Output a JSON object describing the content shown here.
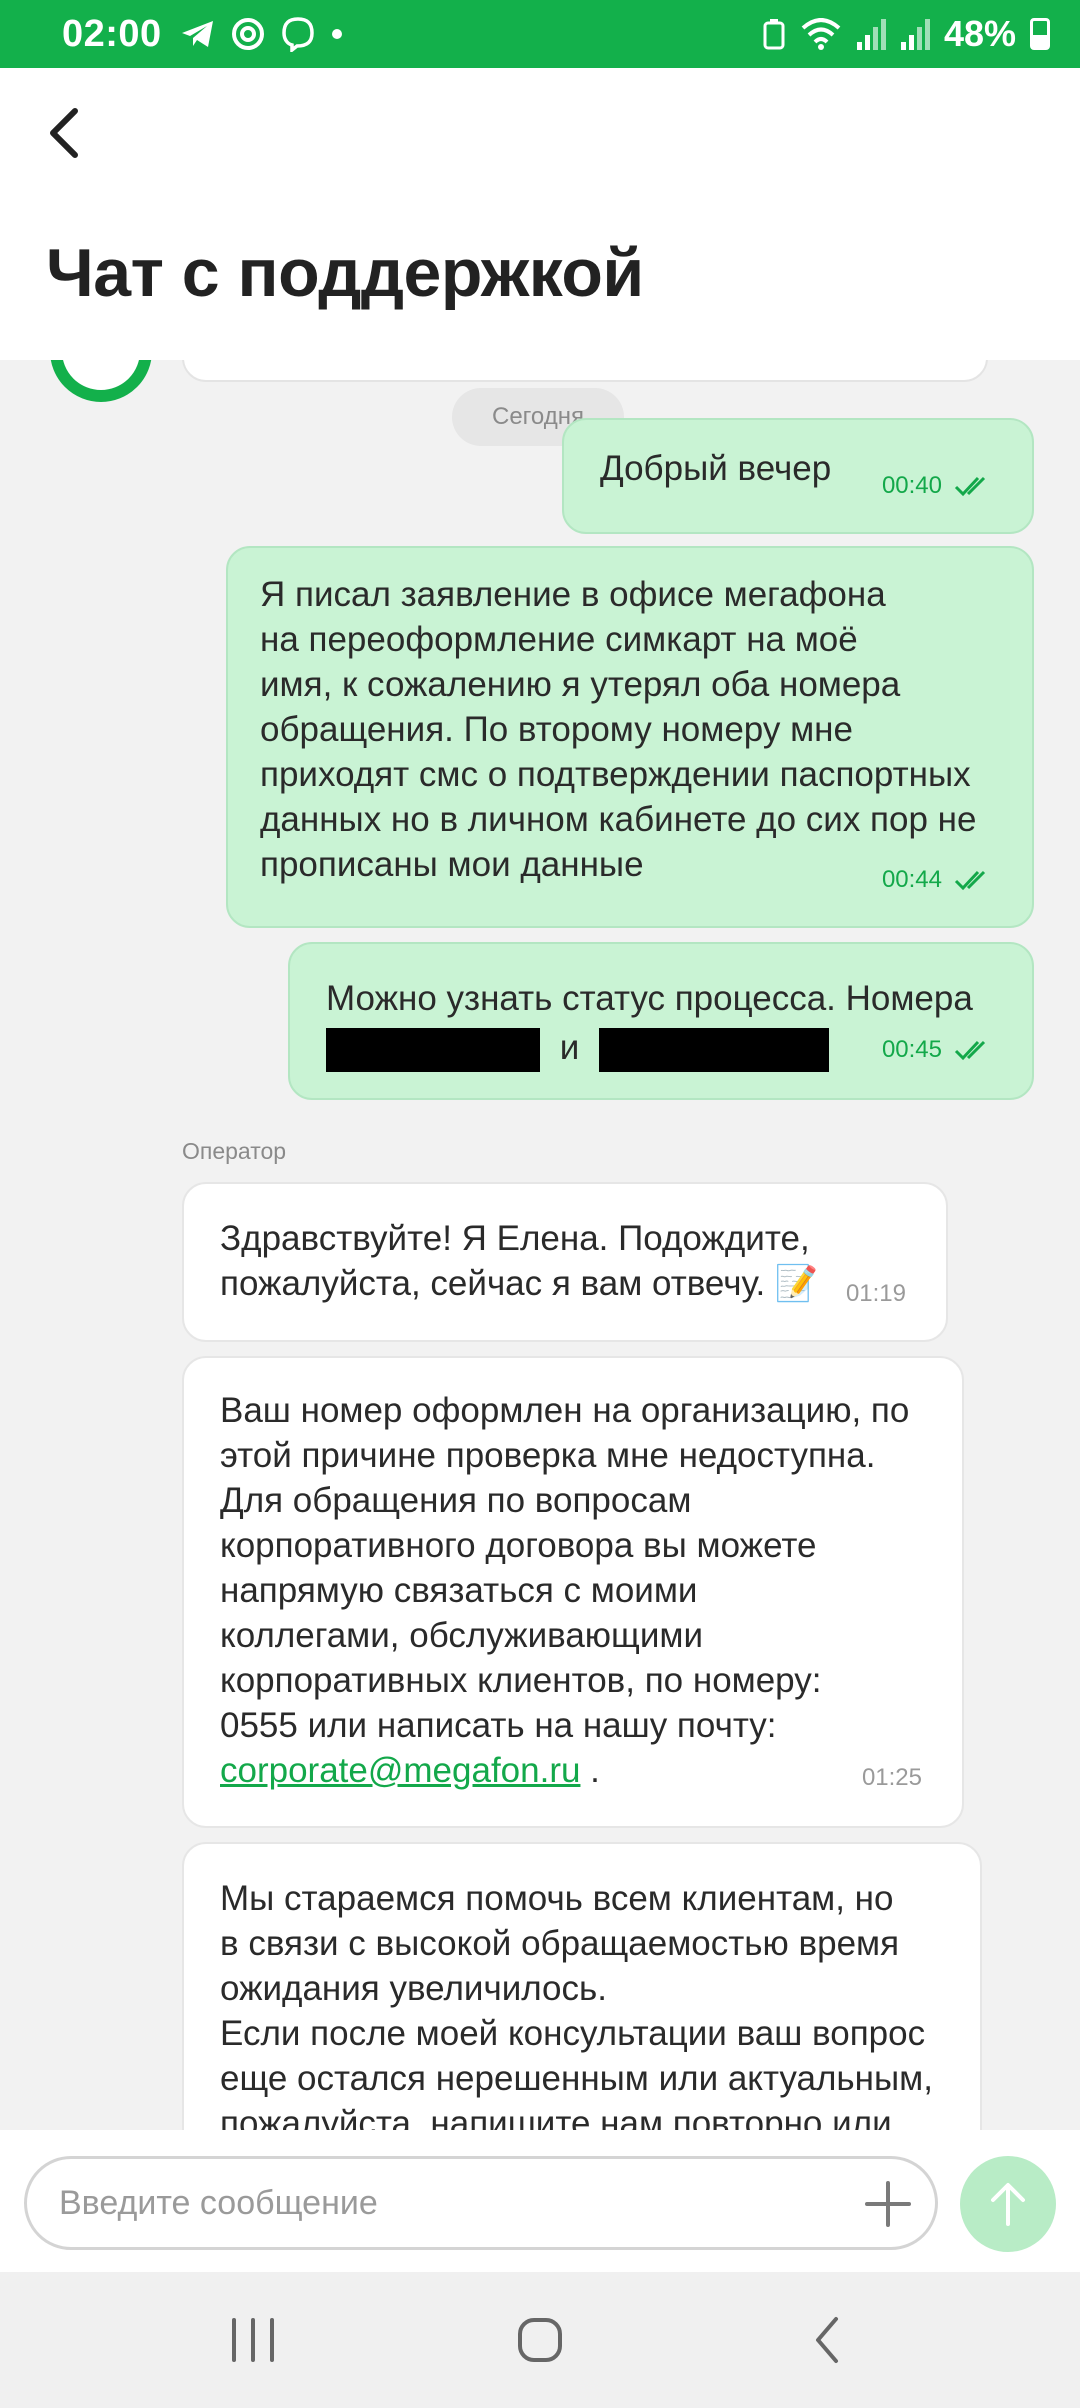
{
  "status_bar": {
    "time": "02:00",
    "battery": "48%",
    "icons": [
      "telegram-icon",
      "at-icon",
      "viber-icon",
      "dot-icon",
      "battery-saver-icon",
      "wifi-icon",
      "signal-icon",
      "signal-icon",
      "battery-icon"
    ]
  },
  "header": {
    "title": "Чат с поддержкой",
    "back_icon": "chevron-left-icon"
  },
  "chat": {
    "date_chip": "Сегодня",
    "operator_label": "Оператор",
    "messages": [
      {
        "side": "out",
        "text": "Добрый вечер",
        "time": "00:40"
      },
      {
        "side": "out",
        "text": "Я писал заявление в офисе мегафона\nна переоформление симкарт на моё\nимя, к сожалению я утерял оба номера\nобращения. По второму номеру мне\nприходят смс о подтверждении паспортных\nданных но в личном кабинете до сих пор не\nпрописаны мои данные",
        "time": "00:44"
      },
      {
        "side": "out",
        "text": "Можно узнать статус процесса. Номера",
        "text_join": "и",
        "time": "00:45"
      },
      {
        "side": "in",
        "text": "Здравствуйте! Я Елена. Подождите,\nпожалуйста, сейчас я вам отвечу. 📝",
        "time": "01:19"
      },
      {
        "side": "in",
        "text": "Ваш номер оформлен на организацию, по\nэтой причине проверка мне недоступна.\nДля обращения по вопросам\nкорпоративного договора вы можете\nнапрямую связаться с моими\nколлегами, обслуживающими\nкорпоративных клиентов, по номеру:\n0555 или написать на нашу почту:",
        "link": "corporate@megafon.ru",
        "link_suffix": " .",
        "time": "01:25"
      },
      {
        "side": "in",
        "text": "Мы стараемся помочь всем клиентам, но\nв связи с высокой обращаемостью время\nожидания увеличилось.\nЕсли после моей консультации ваш вопрос\nеще остался нерешенным или актуальным,\nпожалуйста, напишите нам повторно или"
      }
    ]
  },
  "input": {
    "placeholder": "Введите сообщение"
  },
  "colors": {
    "brand_green": "#13b04b",
    "outgoing_bubble": "#c9f3d4",
    "send_button": "#b8ecc6"
  }
}
